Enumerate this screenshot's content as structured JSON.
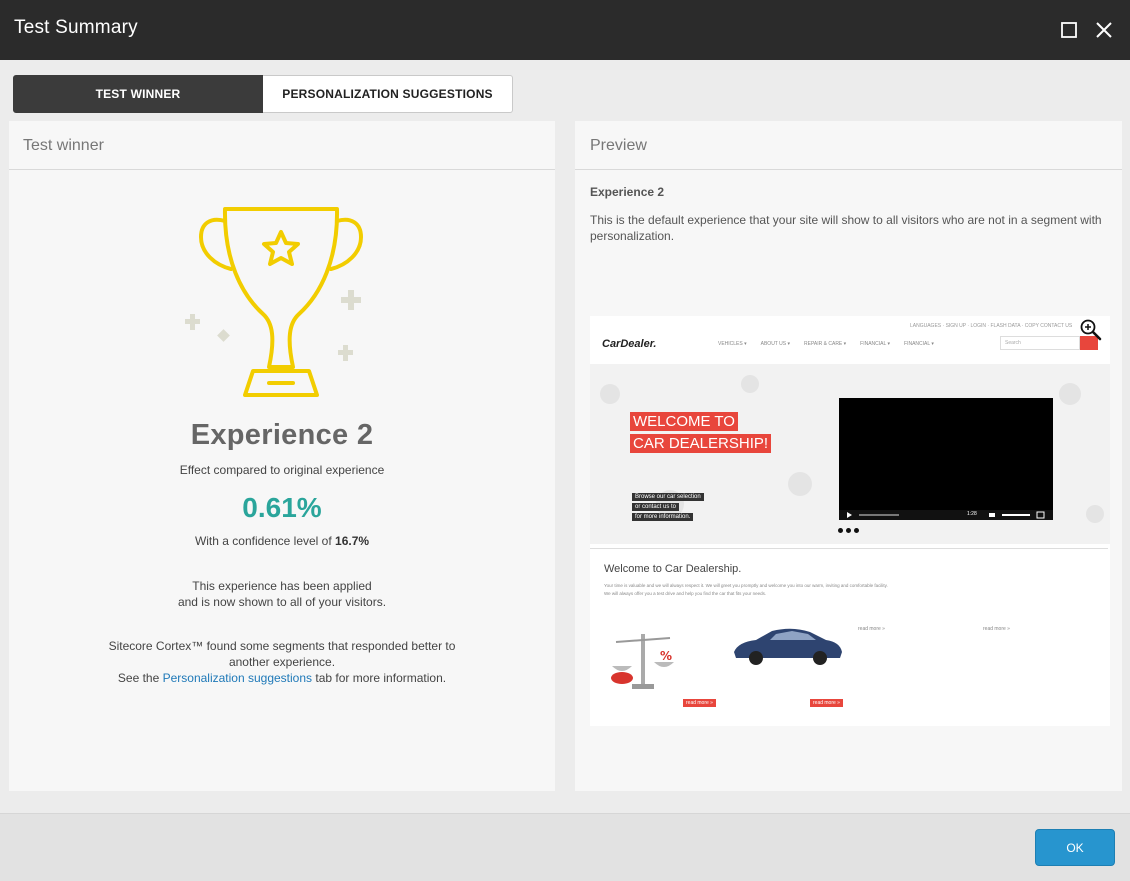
{
  "window": {
    "title": "Test Summary",
    "maximize_icon": "maximize-icon",
    "close_icon": "close-icon"
  },
  "tabs": [
    {
      "label": "TEST WINNER",
      "active": true
    },
    {
      "label": "PERSONALIZATION SUGGESTIONS",
      "active": false
    }
  ],
  "winner_panel": {
    "header": "Test winner",
    "icon": "trophy-icon",
    "experience_name": "Experience 2",
    "effect_label": "Effect compared to original experience",
    "effect_value": "0.61%",
    "confidence_prefix": "With a confidence level of ",
    "confidence_value": "16.7%",
    "applied_line1": "This experience has been applied",
    "applied_line2": "and is now shown to all of your visitors.",
    "cortex_line1": "Sitecore Cortex™ found some segments that responded better to",
    "cortex_line2": "another experience.",
    "cortex_see": "See the ",
    "cortex_link": "Personalization suggestions",
    "cortex_tail": " tab for more information."
  },
  "preview_panel": {
    "header": "Preview",
    "experience_name": "Experience 2",
    "description": "This is the default experience that your site will show to all visitors who are not in a segment with personalization.",
    "zoom_icon": "zoom-in-icon",
    "thumbnail": {
      "logo": "CarDealer.",
      "top_links": "LANGUAGES · SIGN UP · LOGIN · FLASH DATA · COPY CONTACT US",
      "nav": [
        "VEHICLES ▾",
        "ABOUT US ▾",
        "REPAIR & CARE ▾",
        "FINANCIAL ▾",
        "FINANCIAL ▾"
      ],
      "search_placeholder": "Search",
      "hero_line1": "WELCOME TO",
      "hero_line2": "CAR DEALERSHIP!",
      "hero_sub1": "Browse our car selection",
      "hero_sub2": "or contact us to",
      "hero_sub3": "for more information.",
      "video_time": "1:28",
      "section_title": "Welcome to Car Dealership.",
      "section_text1": "Your time is valuable and we will always respect it. We will greet you promptly and welcome you into our warm, inviting and comfortable facility.",
      "section_text2": "We will always offer you a test drive and help you find the car that fits your needs.",
      "read_more": "read more »",
      "colors": {
        "accent": "#e8463c"
      }
    }
  },
  "footer": {
    "ok_label": "OK"
  },
  "colors": {
    "title_bar": "#2b2b2b",
    "active_tab": "#3b3b3b",
    "effect_value": "#2aa59b",
    "link": "#1f79b8",
    "ok_button": "#2795cf",
    "trophy": "#f2cd00"
  }
}
